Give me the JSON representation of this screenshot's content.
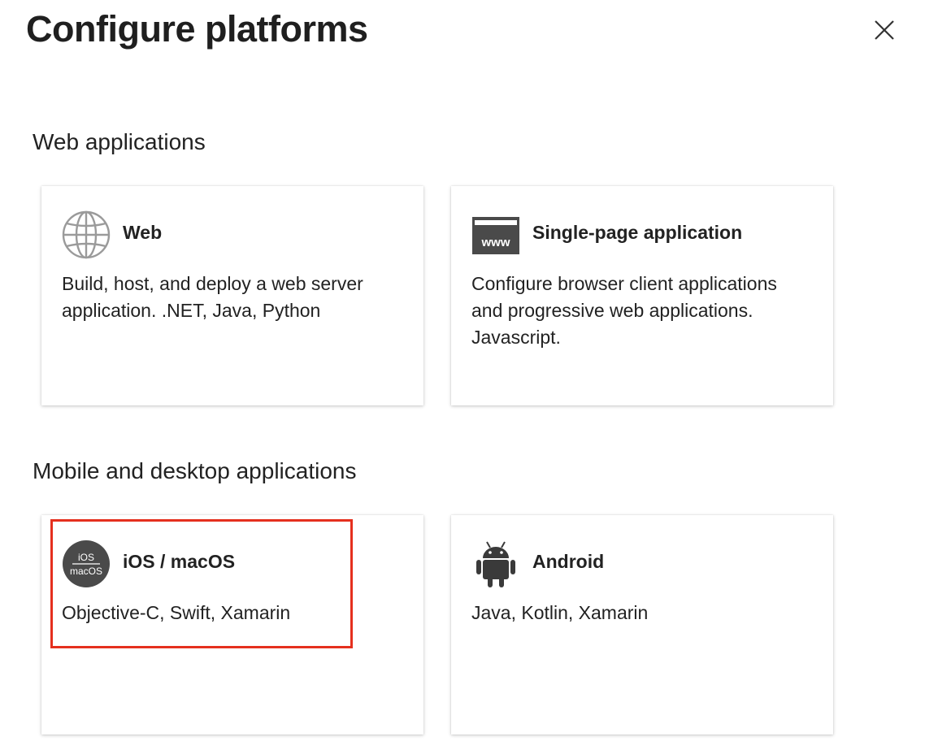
{
  "dialog": {
    "title": "Configure platforms"
  },
  "sections": [
    {
      "heading": "Web applications",
      "cards": [
        {
          "icon": "globe-icon",
          "title": "Web",
          "description": "Build, host, and deploy a web server application. .NET, Java, Python"
        },
        {
          "icon": "www-browser-icon",
          "icon_text": "www",
          "title": "Single-page application",
          "description": "Configure browser client applications and progressive web applications. Javascript."
        }
      ]
    },
    {
      "heading": "Mobile and desktop applications",
      "cards": [
        {
          "icon": "ios-macos-icon",
          "icon_text_top": "iOS",
          "icon_text_bottom": "macOS",
          "title": "iOS / macOS",
          "description": "Objective-C, Swift, Xamarin"
        },
        {
          "icon": "android-icon",
          "title": "Android",
          "description": "Java, Kotlin, Xamarin"
        }
      ]
    }
  ],
  "colors": {
    "highlight_border": "#e5301e",
    "icon_dark": "#4a4a4a",
    "globe_stroke": "#9a9a9a"
  }
}
